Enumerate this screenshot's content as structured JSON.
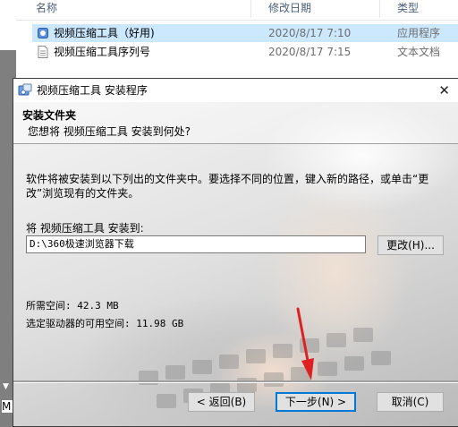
{
  "explorer": {
    "columns": {
      "name": "名称",
      "date": "修改日期",
      "type": "类型"
    },
    "files": [
      {
        "name": "视频压缩工具（好用)",
        "date": "2020/8/17 7:10",
        "type": "应用程序",
        "icon": "app-icon",
        "selected": true
      },
      {
        "name": "视频压缩工具序列号",
        "date": "2020/8/17 7:15",
        "type": "文本文档",
        "icon": "text-file-icon",
        "selected": false
      }
    ],
    "bottom_letter": "M"
  },
  "installer": {
    "title": "视频压缩工具 安装程序",
    "close_symbol": "✕",
    "header_title": "安装文件夹",
    "header_subtitle": "您想将 视频压缩工具 安装到何处?",
    "description": "软件将被安装到以下列出的文件夹中。要选择不同的位置，键入新的路径，或单击“更改”浏览现有的文件夹。",
    "target_label": "将 视频压缩工具 安装到:",
    "install_path": "D:\\360极速浏览器下载",
    "change_button": "更改(H)...",
    "required_space": "所需空间: 42.3 MB",
    "available_space": "选定驱动器的可用空间: 11.98 GB",
    "back_button": "< 返回(B)",
    "next_button": "下一步(N) >",
    "cancel_button": "取消(C)"
  },
  "colors": {
    "selection": "#cce8ff",
    "default_button_border": "#0078d7",
    "arrow": "#e02020"
  }
}
